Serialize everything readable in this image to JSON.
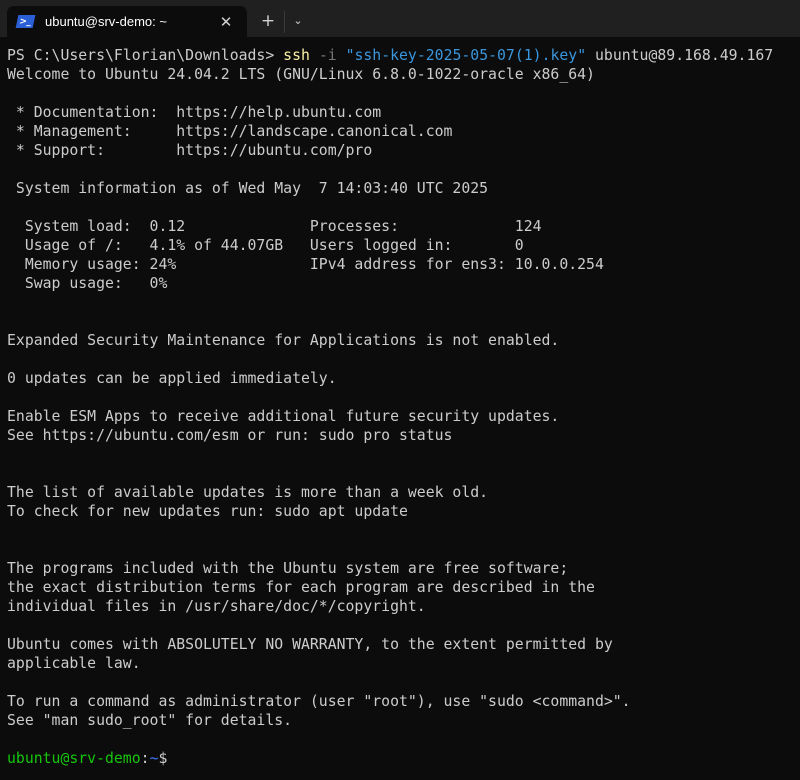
{
  "tab": {
    "title": "ubuntu@srv-demo: ~",
    "icon": "powershell-icon",
    "close": "✕",
    "new_tab": "+",
    "dropdown": "⌄"
  },
  "colors": {
    "background": "#0c0c0c",
    "text": "#cccccc",
    "command": "#f9f1a5",
    "flag": "#767676",
    "string": "#3a96dd",
    "prompt_user": "#16c60c",
    "prompt_path": "#3b78ff"
  },
  "terminal": {
    "lines": [
      [
        {
          "t": "PS C:\\Users\\Florian\\Downloads> ",
          "c": "default"
        },
        {
          "t": "ssh",
          "c": "yellow"
        },
        {
          "t": " ",
          "c": "default"
        },
        {
          "t": "-i",
          "c": "gray"
        },
        {
          "t": " ",
          "c": "default"
        },
        {
          "t": "\"ssh-key-2025-05-07(1).key\"",
          "c": "blue"
        },
        {
          "t": " ubuntu@89.168.49.167",
          "c": "default"
        }
      ],
      [
        {
          "t": "Welcome to Ubuntu 24.04.2 LTS (GNU/Linux 6.8.0-1022-oracle x86_64)",
          "c": "default"
        }
      ],
      [],
      [
        {
          "t": " * Documentation:  https://help.ubuntu.com",
          "c": "default"
        }
      ],
      [
        {
          "t": " * Management:     https://landscape.canonical.com",
          "c": "default"
        }
      ],
      [
        {
          "t": " * Support:        https://ubuntu.com/pro",
          "c": "default"
        }
      ],
      [],
      [
        {
          "t": " System information as of Wed May  7 14:03:40 UTC 2025",
          "c": "default"
        }
      ],
      [],
      [
        {
          "t": "  System load:  0.12              Processes:             124",
          "c": "default"
        }
      ],
      [
        {
          "t": "  Usage of /:   4.1% of 44.07GB   Users logged in:       0",
          "c": "default"
        }
      ],
      [
        {
          "t": "  Memory usage: 24%               IPv4 address for ens3: 10.0.0.254",
          "c": "default"
        }
      ],
      [
        {
          "t": "  Swap usage:   0%",
          "c": "default"
        }
      ],
      [],
      [],
      [
        {
          "t": "Expanded Security Maintenance for Applications is not enabled.",
          "c": "default"
        }
      ],
      [],
      [
        {
          "t": "0 updates can be applied immediately.",
          "c": "default"
        }
      ],
      [],
      [
        {
          "t": "Enable ESM Apps to receive additional future security updates.",
          "c": "default"
        }
      ],
      [
        {
          "t": "See https://ubuntu.com/esm or run: sudo pro status",
          "c": "default"
        }
      ],
      [],
      [],
      [
        {
          "t": "The list of available updates is more than a week old.",
          "c": "default"
        }
      ],
      [
        {
          "t": "To check for new updates run: sudo apt update",
          "c": "default"
        }
      ],
      [],
      [],
      [
        {
          "t": "The programs included with the Ubuntu system are free software;",
          "c": "default"
        }
      ],
      [
        {
          "t": "the exact distribution terms for each program are described in the",
          "c": "default"
        }
      ],
      [
        {
          "t": "individual files in /usr/share/doc/*/copyright.",
          "c": "default"
        }
      ],
      [],
      [
        {
          "t": "Ubuntu comes with ABSOLUTELY NO WARRANTY, to the extent permitted by",
          "c": "default"
        }
      ],
      [
        {
          "t": "applicable law.",
          "c": "default"
        }
      ],
      [],
      [
        {
          "t": "To run a command as administrator (user \"root\"), use \"sudo <command>\".",
          "c": "default"
        }
      ],
      [
        {
          "t": "See \"man sudo_root\" for details.",
          "c": "default"
        }
      ],
      [],
      [
        {
          "t": "ubuntu@srv-demo",
          "c": "green"
        },
        {
          "t": ":",
          "c": "default"
        },
        {
          "t": "~",
          "c": "tilde"
        },
        {
          "t": "$",
          "c": "default"
        }
      ]
    ]
  }
}
